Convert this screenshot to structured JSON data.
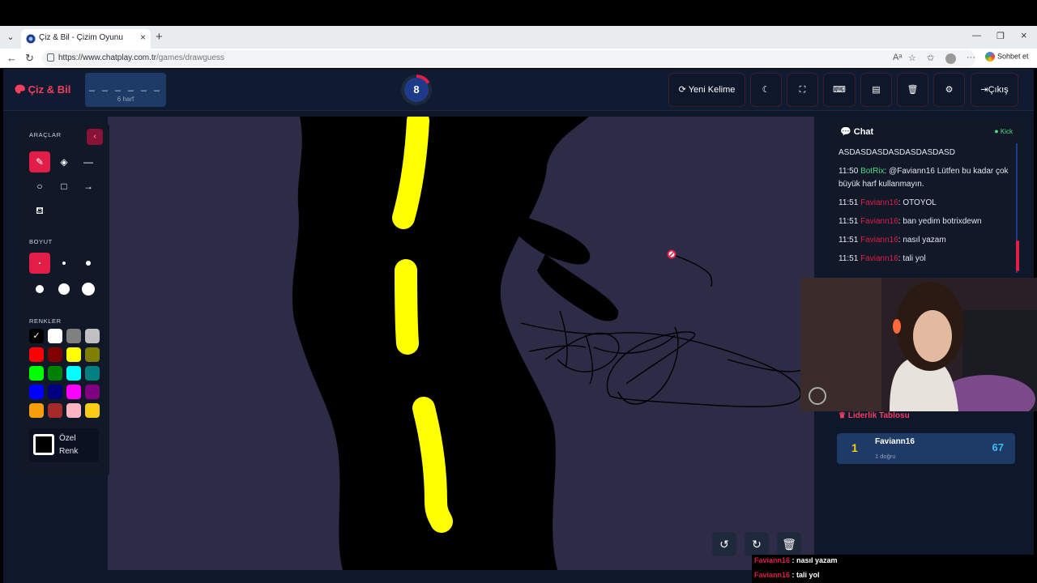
{
  "browser": {
    "tab_title": "Çiz & Bil - Çizim Oyunu",
    "url_domain": "https://www.chatplay.com.tr",
    "url_path": "/games/drawguess",
    "sohbet_label": "Sohbet et"
  },
  "header": {
    "logo": "Çiz & Bil",
    "word_mask": "_ _ _ _ _ _",
    "word_hint": "6 harf",
    "timer": "8",
    "new_word": "Yeni Kelime",
    "exit": "Çıkış"
  },
  "tools": {
    "section_tools": "ARAÇLAR",
    "section_size": "BOYUT",
    "section_colors": "RENKLER",
    "custom_line1": "Özel",
    "custom_line2": "Renk",
    "colors": [
      "#000000",
      "#ffffff",
      "#808080",
      "#c0c0c0",
      "#ff0000",
      "#800000",
      "#ffff00",
      "#808000",
      "#00ff00",
      "#008000",
      "#00ffff",
      "#008080",
      "#0000ff",
      "#000080",
      "#ff00ff",
      "#800080",
      "#f59e0b",
      "#a52a2a",
      "#ffb6c1",
      "#facc15"
    ]
  },
  "chat": {
    "title": "Chat",
    "status": "Kick",
    "messages": [
      {
        "text": "ASDASDASDASDASDASDASD"
      },
      {
        "time": "11:50",
        "user": "BotRix",
        "text": ": @Faviann16 Lütfen bu kadar çok büyük harf kullanmayın."
      },
      {
        "time": "11:51",
        "user": "Faviann16",
        "text": ": OTOYOL"
      },
      {
        "time": "11:51",
        "user": "Faviann16",
        "text": ": ban yedim botrixdewn"
      },
      {
        "time": "11:51",
        "user": "Faviann16",
        "text": ": nasıl yazam"
      },
      {
        "time": "11:51",
        "user": "Faviann16",
        "text": ": tali yol"
      }
    ]
  },
  "leaderboard": {
    "title": "Liderlik Tablosu",
    "rows": [
      {
        "rank": "1",
        "name": "Faviann16",
        "sub": "1 doğru",
        "score": "67"
      }
    ]
  },
  "overlay_chat": [
    {
      "user": "Faviann16",
      "text": " : nasıl yazam"
    },
    {
      "user": "Faviann16",
      "text": " : tali yol"
    }
  ]
}
